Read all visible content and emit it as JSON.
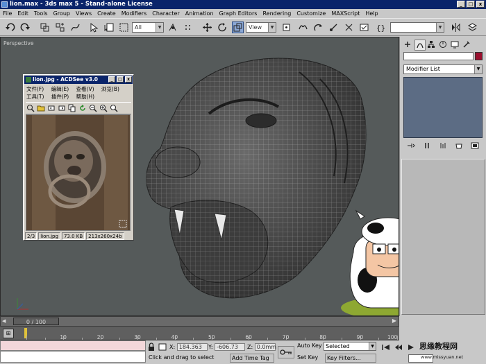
{
  "window": {
    "title": "lion.max - 3ds max 5 - Stand-alone License",
    "minimize": "_",
    "maximize": "□",
    "close": "x"
  },
  "menu": [
    "File",
    "Edit",
    "Tools",
    "Group",
    "Views",
    "Create",
    "Modifiers",
    "Character",
    "Animation",
    "Graph Editors",
    "Rendering",
    "Customize",
    "MAXScript",
    "Help"
  ],
  "toolbar": {
    "selection_filter": "All",
    "reference_coord": "View"
  },
  "viewport": {
    "label": "Perspective"
  },
  "command_panel": {
    "modifier_list": "Modifier List",
    "accent_color": "#9a0f2e"
  },
  "acdsee": {
    "title": "lion.jpg - ACDSee v3.0",
    "menu_row1": [
      "文件(F)",
      "编辑(E)",
      "查看(V)",
      "浏览(B)"
    ],
    "menu_row2": [
      "工具(T)",
      "插件(P)",
      "帮助(H)"
    ],
    "status": {
      "index": "2/3",
      "filename": "lion.jpg",
      "filesize": "73.0 KB",
      "dimensions": "213x260x24b"
    }
  },
  "timeline": {
    "frame_display": "0 / 100",
    "ruler_labels": [
      "10",
      "20",
      "30",
      "40",
      "50",
      "60",
      "70",
      "80",
      "90",
      "100"
    ]
  },
  "status": {
    "x_label": "X:",
    "x_value": "184.363",
    "y_label": "Y:",
    "y_value": "-606.73",
    "z_label": "Z:",
    "z_value": "0.0mm",
    "prompt": "Click and drag to select",
    "add_time_tag": "Add Time Tag",
    "auto_key": "Auto Key",
    "set_key": "Set Key",
    "key_mode": "Selected",
    "key_filters": "Key Filters...",
    "watermark_title": "思缘教程网",
    "watermark_url": "www.missyuan.net"
  }
}
